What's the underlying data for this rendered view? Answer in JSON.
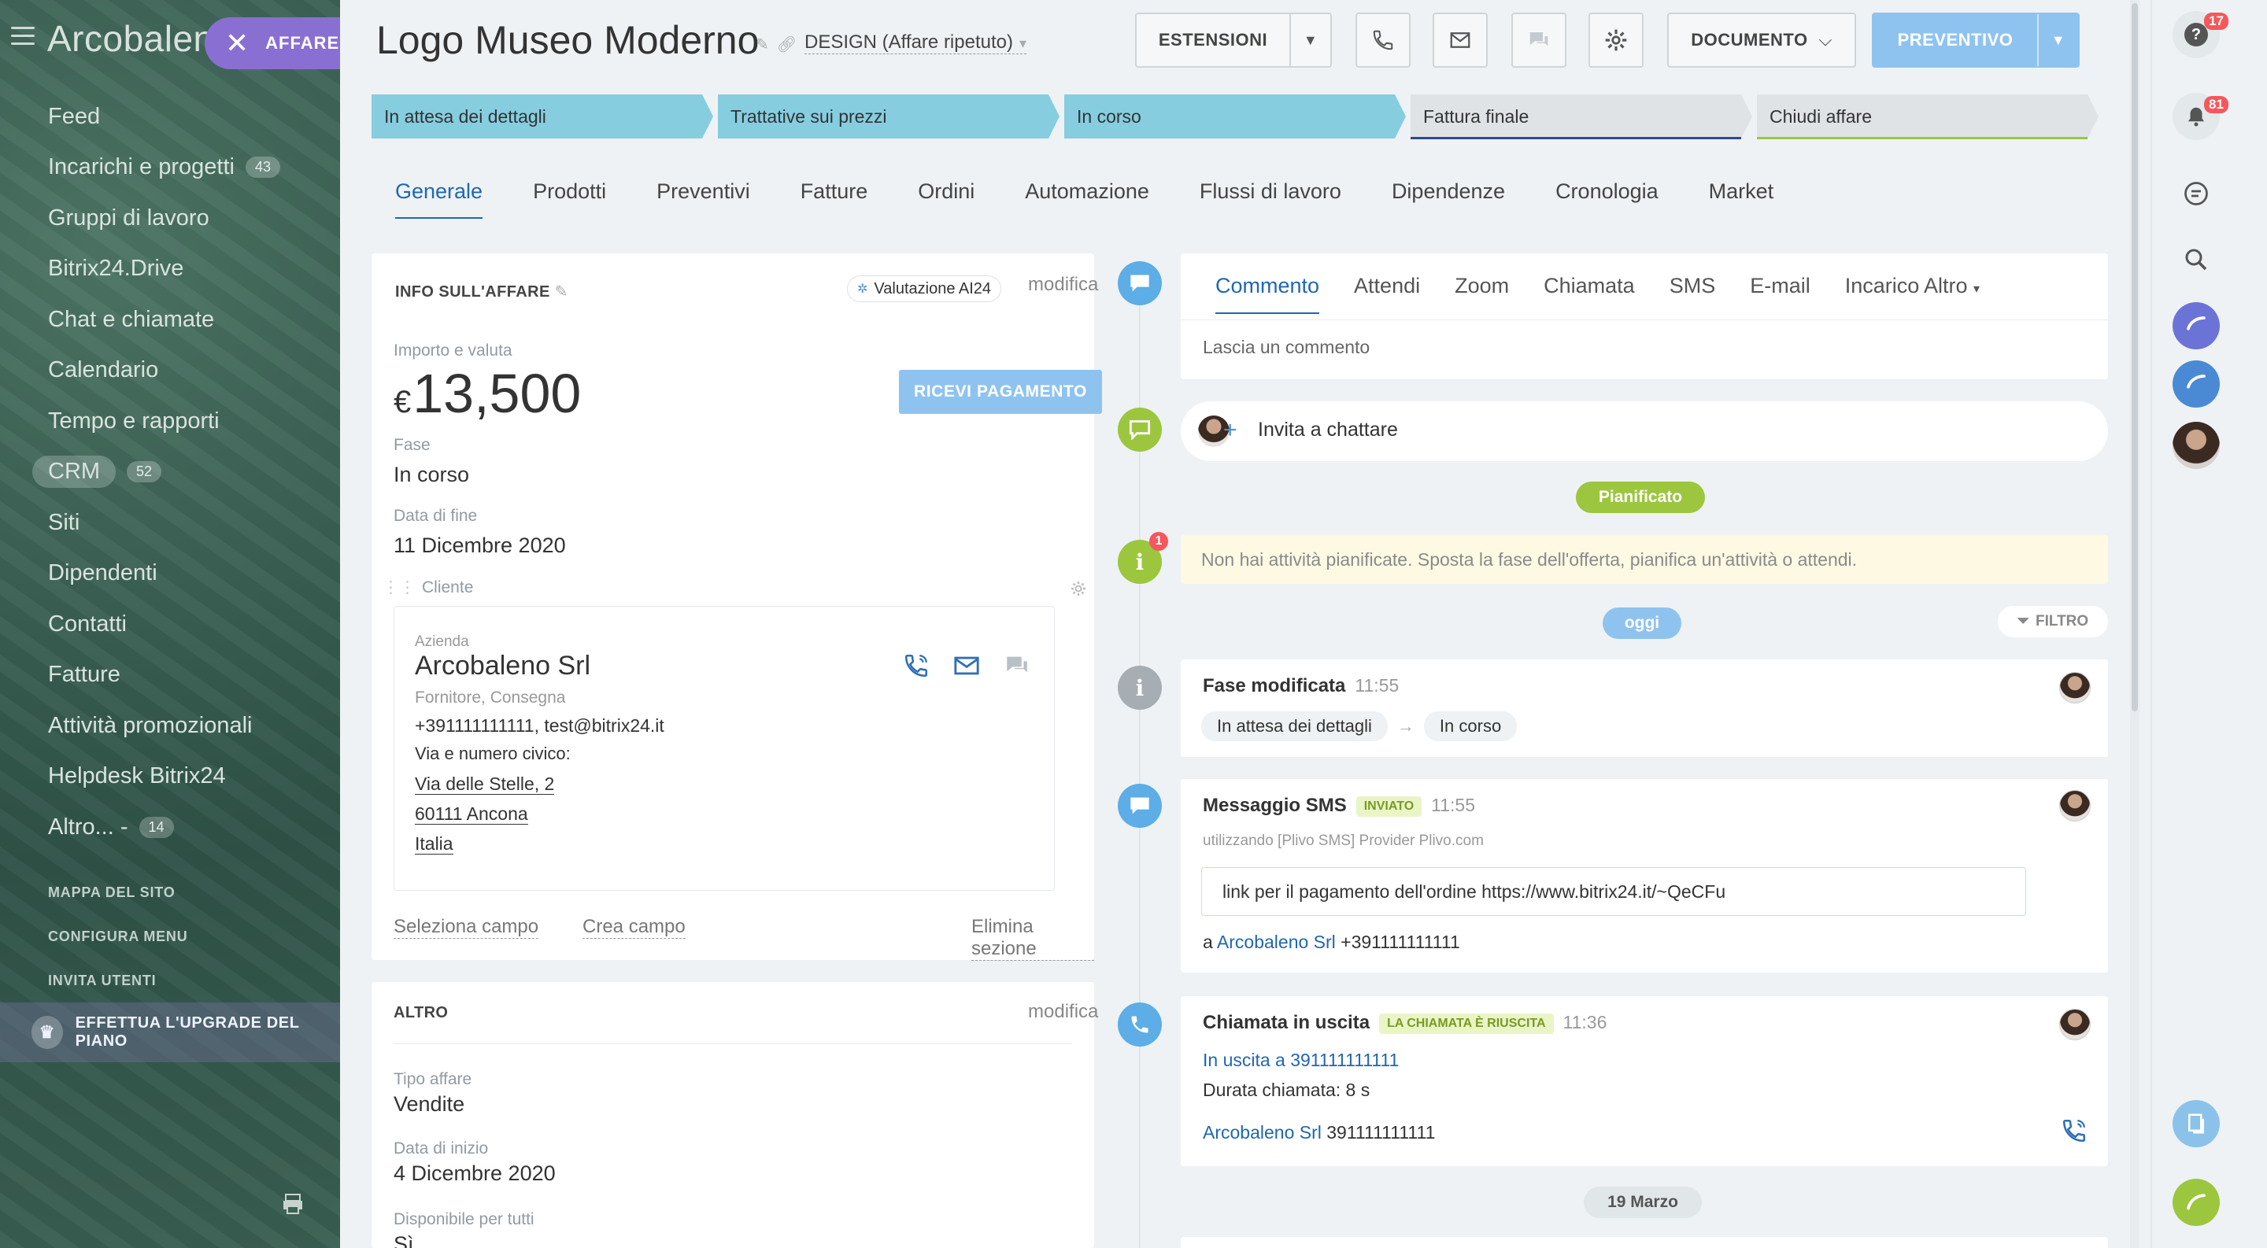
{
  "sidebar": {
    "brand": "Arcobaleno",
    "affare_label": "AFFARE",
    "items": [
      {
        "label": "Feed",
        "count": ""
      },
      {
        "label": "Incarichi e progetti",
        "count": "43"
      },
      {
        "label": "Gruppi di lavoro",
        "count": ""
      },
      {
        "label": "Bitrix24.Drive",
        "count": ""
      },
      {
        "label": "Chat e chiamate",
        "count": ""
      },
      {
        "label": "Calendario",
        "count": ""
      },
      {
        "label": "Tempo e rapporti",
        "count": ""
      },
      {
        "label": "CRM",
        "count": "52"
      },
      {
        "label": "Siti",
        "count": ""
      },
      {
        "label": "Dipendenti",
        "count": ""
      },
      {
        "label": "Contatti",
        "count": ""
      },
      {
        "label": "Fatture",
        "count": ""
      },
      {
        "label": "Attività promozionali",
        "count": ""
      },
      {
        "label": "Helpdesk Bitrix24",
        "count": ""
      },
      {
        "label": "Altro... -",
        "count": "14"
      }
    ],
    "sitemap": "MAPPA DEL SITO",
    "configure": "CONFIGURA MENU",
    "invite": "INVITA UTENTI",
    "upgrade": "EFFETTUA L'UPGRADE DEL PIANO"
  },
  "header": {
    "title": "Logo Museo  Moderno",
    "category": "DESIGN (Affare ripetuto)",
    "extensions": "ESTENSIONI",
    "document": "DOCUMENTO",
    "quote": "PREVENTIVO"
  },
  "stages": [
    {
      "label": "In attesa dei dettagli",
      "state": "done"
    },
    {
      "label": "Trattative sui prezzi",
      "state": "done"
    },
    {
      "label": "In corso",
      "state": "done"
    },
    {
      "label": "Fattura finale",
      "state": "todo"
    },
    {
      "label": "Chiudi affare",
      "state": "todo"
    }
  ],
  "tabs": [
    "Generale",
    "Prodotti",
    "Preventivi",
    "Fatture",
    "Ordini",
    "Automazione",
    "Flussi di lavoro",
    "Dipendenze",
    "Cronologia",
    "Market"
  ],
  "deal_info": {
    "heading": "INFO SULL'AFFARE",
    "ai_badge": "Valutazione AI24",
    "edit": "modifica",
    "amount_label": "Importo e valuta",
    "currency": "€",
    "amount": "13,500",
    "pay_button": "RICEVI PAGAMENTO",
    "stage_label": "Fase",
    "stage_value": "In corso",
    "end_label": "Data di fine",
    "end_value": "11 Dicembre 2020",
    "client_label": "Cliente",
    "client": {
      "type": "Azienda",
      "name": "Arcobaleno Srl",
      "role": "Fornitore, Consegna",
      "contacts": "+391111111111, test@bitrix24.it",
      "address_label": "Via e numero civico:",
      "street": "Via delle Stelle, 2",
      "city": "60111 Ancona",
      "country": "Italia"
    },
    "select_field": "Seleziona campo",
    "create_field": "Crea campo",
    "delete_section": "Elimina sezione"
  },
  "other_info": {
    "heading": "ALTRO",
    "edit": "modifica",
    "type_label": "Tipo affare",
    "type_value": "Vendite",
    "start_label": "Data di inizio",
    "start_value": "4 Dicembre 2020",
    "avail_label": "Disponibile per tutti",
    "avail_value": "Sì"
  },
  "timeline": {
    "tabs": [
      "Commento",
      "Attendi",
      "Zoom",
      "Chiamata",
      "SMS",
      "E-mail",
      "Incarico"
    ],
    "more": "Altro",
    "comment_placeholder": "Lascia un commento",
    "invite_chat": "Invita a chattare",
    "planned": "Pianificato",
    "no_activity": "Non hai attività pianificate. Sposta la fase dell'offerta, pianifica un'attività o attendi.",
    "no_activity_count": "1",
    "today": "oggi",
    "filter": "FILTRO",
    "stage_change": {
      "title": "Fase modificata",
      "time": "11:55",
      "from": "In attesa dei dettagli",
      "to": "In corso"
    },
    "sms": {
      "title": "Messaggio SMS",
      "badge": "INVIATO",
      "time": "11:55",
      "provider": "utilizzando [Plivo SMS] Provider Plivo.com",
      "text": "link per il pagamento dell'ordine https://www.bitrix24.it/~QeCFu",
      "to_prefix": "a",
      "to_name": "Arcobaleno Srl",
      "to_phone": "+391111111111"
    },
    "call": {
      "title": "Chiamata in uscita",
      "badge": "LA CHIAMATA È RIUSCITA",
      "time": "11:36",
      "outgoing": "In uscita a 391111111111",
      "duration": "Durata chiamata: 8 s",
      "contact_name": "Arcobaleno Srl",
      "contact_phone": "391111111111"
    },
    "date_divider": "19 Marzo"
  },
  "rightbar": {
    "help_count": "17",
    "notif_count": "81"
  },
  "colors": {
    "accent": "#2067b0",
    "stage_done": "#86cde0",
    "primary_btn": "#8fc3ef",
    "green": "#9cc63e",
    "purple": "#8a6fd3"
  }
}
